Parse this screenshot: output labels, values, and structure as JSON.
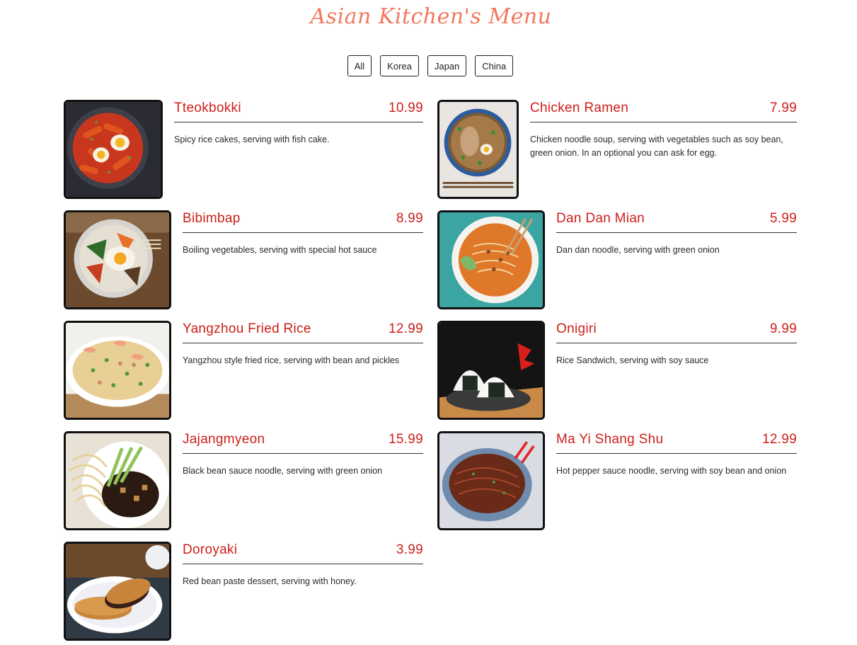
{
  "page": {
    "title": "Asian Kitchen's Menu"
  },
  "filters": [
    {
      "label": "All"
    },
    {
      "label": "Korea"
    },
    {
      "label": "Japan"
    },
    {
      "label": "China"
    }
  ],
  "menu": [
    {
      "name": "Tteokbokki",
      "price": "10.99",
      "desc": "Spicy rice cakes, serving with fish cake.",
      "image": "tteokbokki-photo"
    },
    {
      "name": "Chicken Ramen",
      "price": "7.99",
      "desc": "Chicken noodle soup, serving with vegetables such as soy bean, green onion. In an optional you can ask for egg.",
      "image": "chicken-ramen-photo"
    },
    {
      "name": "Bibimbap",
      "price": "8.99",
      "desc": "Boiling vegetables, serving with special hot sauce",
      "image": "bibimbap-photo"
    },
    {
      "name": "Dan Dan Mian",
      "price": "5.99",
      "desc": "Dan dan noodle, serving with green onion",
      "image": "dan-dan-mian-photo"
    },
    {
      "name": "Yangzhou Fried Rice",
      "price": "12.99",
      "desc": "Yangzhou style fried rice, serving with bean and pickles",
      "image": "yangzhou-fried-rice-photo"
    },
    {
      "name": "Onigiri",
      "price": "9.99",
      "desc": "Rice Sandwich, serving with soy sauce",
      "image": "onigiri-photo"
    },
    {
      "name": "Jajangmyeon",
      "price": "15.99",
      "desc": "Black bean sauce noodle, serving with green onion",
      "image": "jajangmyeon-photo"
    },
    {
      "name": "Ma Yi Shang Shu",
      "price": "12.99",
      "desc": "Hot pepper sauce noodle, serving with soy bean and onion",
      "image": "ma-yi-shang-shu-photo"
    },
    {
      "name": "Doroyaki",
      "price": "3.99",
      "desc": "Red bean paste dessert, serving with honey.",
      "image": "doroyaki-photo"
    }
  ],
  "colors": {
    "title": "#f2785e",
    "item_text": "#cc1f1a",
    "border": "#111111"
  }
}
